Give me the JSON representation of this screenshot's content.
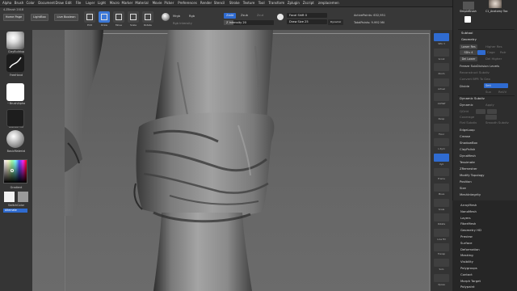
{
  "menubar": [
    "Alpha",
    "Brush",
    "Color",
    "Document",
    "Draw",
    "Edit",
    "File",
    "Layer",
    "Light",
    "Macro",
    "Marker",
    "Material",
    "Movie",
    "Picker",
    "Preferences",
    "Render",
    "Stencil",
    "Stroke",
    "Texture",
    "Tool",
    "Transform",
    "Zplugin",
    "Zscript",
    "zreplacemen"
  ],
  "version": "4.ZBrush 2018",
  "topbar": {
    "home_page": "Home Page",
    "lightbox": "LightBox",
    "live_boolean": "Live Boolean",
    "tools": [
      {
        "name": "Edit",
        "active": false
      },
      {
        "name": "Draw",
        "active": true
      },
      {
        "name": "Move",
        "active": false
      },
      {
        "name": "Scale",
        "active": false
      },
      {
        "name": "Rotate",
        "active": false
      }
    ],
    "mrgb": "Mrgb",
    "rgb": "Rgb",
    "rgb_intensity": "Rgb Intensity",
    "zadd": "Zadd",
    "zsub": "Zsub",
    "zcut": "Zcut",
    "z_intensity_label": "Z Intensity 20",
    "z_intensity": 20,
    "focal_shift_label": "Focal Shift 0",
    "draw_size_label": "Draw Size 25",
    "dynamic": "Dynamic",
    "active_points": "ActivePoints: 632,951",
    "total_points": "TotalPoints: 9.992 Mil"
  },
  "left": {
    "brush": "ClayBuildup",
    "stroke": "FreeHand",
    "alpha": "~BrushAlpha",
    "texture": "Texture Off",
    "material": "BasicMaterial",
    "gradient": "Gradient",
    "switch_color": "SwitchColor",
    "alternate": "Alternate"
  },
  "righttools": [
    {
      "label": "SPix 3",
      "blue": true
    },
    {
      "label": "Scroll",
      "blue": false
    },
    {
      "label": "Zoom",
      "blue": false
    },
    {
      "label": "Actual",
      "blue": false
    },
    {
      "label": "AAHalf",
      "blue": false
    },
    {
      "label": "Persp",
      "blue": false
    },
    {
      "label": "Floor",
      "blue": false
    },
    {
      "label": "L.Sym",
      "blue": false
    },
    {
      "label": "Xyz",
      "blue": true
    },
    {
      "label": "Frame",
      "blue": false
    },
    {
      "label": "Move",
      "blue": false
    },
    {
      "label": "Scale",
      "blue": false
    },
    {
      "label": "Rotate",
      "blue": false
    },
    {
      "label": "Line Fill",
      "blue": false
    },
    {
      "label": "Transp",
      "blue": false
    },
    {
      "label": "Solo",
      "blue": false
    },
    {
      "label": "Xpose",
      "blue": false
    }
  ],
  "rpanel": {
    "simple_brush": "SimpleBrush",
    "c1": "C1_Anatomy Too",
    "subtool": "Subtool",
    "geometry": "Geometry",
    "lower_res": "Lower Res",
    "higher_res": "Higher Res",
    "sdiv": "SDiv 4",
    "cage": "Cage",
    "rstr": "Rstr",
    "del_lower": "Del Lower",
    "del_higher": "Del Higher",
    "freeze": "Freeze SubDivision Levels",
    "reconstruct": "Reconstruct Subdiv",
    "convert": "Convert BPR To Geo",
    "divide": "Divide",
    "smt": "Smt",
    "suv": "Suv",
    "reuv": "ReUV",
    "dynamic_subdiv": "Dynamic Subdiv",
    "dynamic": "Dynamic",
    "apply": "Apply",
    "qgrid": "QGrid",
    "coverage": "Coverage",
    "flat_subdiv": "Flat Subdiv",
    "smooth_subdiv": "Smooth Subdiv",
    "edgeloop": "EdgeLoop",
    "crease": "Crease",
    "shadowbox": "ShadowBox",
    "claypolish": "ClayPolish",
    "dynamesh": "DynaMesh",
    "tessimate": "Tessimate",
    "zremesher": "ZRemesher",
    "modify_topology": "Modify Topology",
    "position": "Position",
    "size": "Size",
    "meshintegrity": "MeshIntegrity",
    "sub": [
      "ArrayMesh",
      "NanoMesh",
      "Layers",
      "FiberMesh",
      "Geometry HD",
      "Preview",
      "Surface",
      "Deformation",
      "Masking",
      "Visibility",
      "Polygroups",
      "Contact",
      "Morph Target",
      "Polypaint"
    ]
  }
}
